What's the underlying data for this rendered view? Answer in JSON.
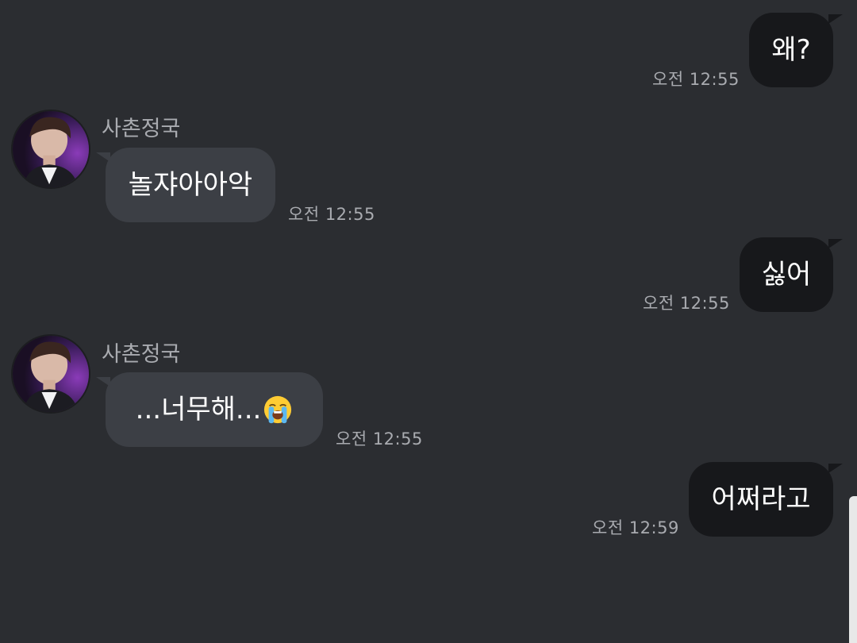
{
  "messages": [
    {
      "direction": "out",
      "text": "왜?",
      "time": "오전 12:55"
    },
    {
      "direction": "in",
      "sender": "사촌정국",
      "text": "놀쟈아아악",
      "time": "오전 12:55"
    },
    {
      "direction": "out",
      "text": "싫어",
      "time": "오전 12:55"
    },
    {
      "direction": "in",
      "sender": "사촌정국",
      "text": "...너무해...",
      "emoji": "loudly-crying-face",
      "time": "오전 12:55"
    },
    {
      "direction": "out",
      "text": "어쩌라고",
      "time": "오전 12:59"
    }
  ],
  "colors": {
    "background": "#2b2d31",
    "incoming_bubble": "#3c3f45",
    "outgoing_bubble": "#17181b",
    "meta_text": "#a9abb0"
  }
}
